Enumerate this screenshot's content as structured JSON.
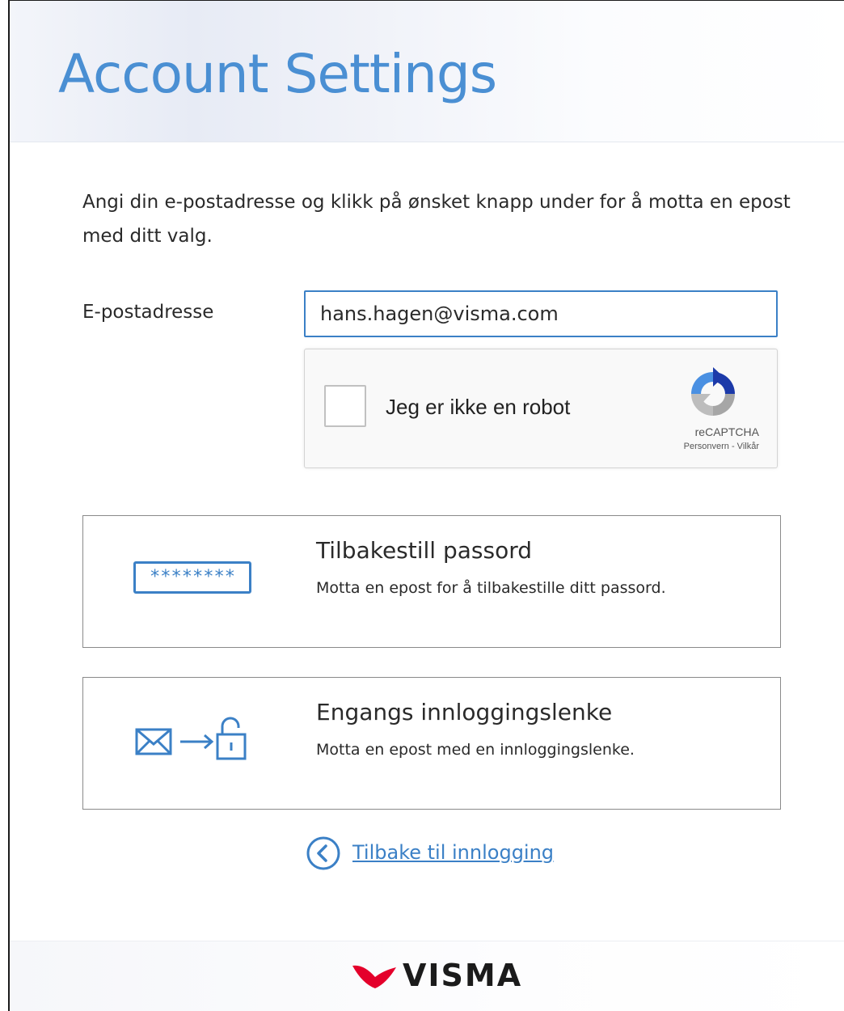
{
  "header": {
    "title": "Account Settings"
  },
  "intro": {
    "text": "Angi din e-postadresse og klikk på ønsket knapp under for å motta en epost med ditt valg."
  },
  "email": {
    "label": "E-postadresse",
    "value": "hans.hagen@visma.com"
  },
  "captcha": {
    "label": "Jeg er ikke en robot",
    "brand": "reCAPTCHA",
    "links": "Personvern - Vilkår",
    "checked": false
  },
  "options": [
    {
      "title": "Tilbakestill passord",
      "description": "Motta en epost for å tilbakestille ditt passord.",
      "icon": "password-icon",
      "icon_text": "********"
    },
    {
      "title": "Engangs innloggingslenke",
      "description": "Motta en epost med en innloggingslenke.",
      "icon": "mail-to-lock-icon"
    }
  ],
  "back": {
    "label": "Tilbake til innlogging",
    "icon": "chevron-left-circle-icon"
  },
  "footer": {
    "logo_text": "VISMA"
  },
  "colors": {
    "accent": "#3b80c6",
    "title": "#4a8fd3",
    "logo_red": "#e4002b"
  }
}
